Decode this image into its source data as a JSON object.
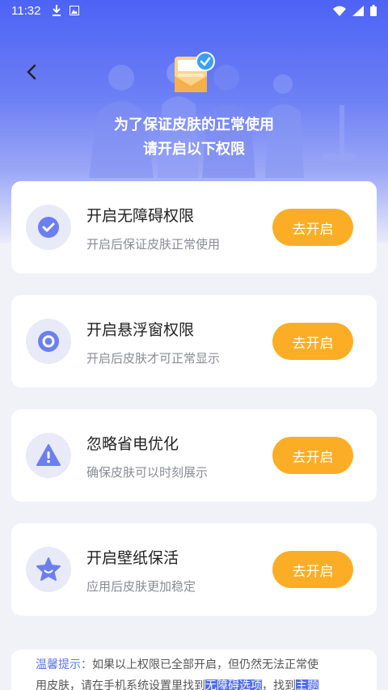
{
  "status_bar": {
    "time": "11:32"
  },
  "header": {
    "line1": "为了保证皮肤的正常使用",
    "line2": "请开启以下权限"
  },
  "permissions": [
    {
      "title": "开启无障碍权限",
      "subtitle": "开启后保证皮肤正常使用",
      "button": "去开启",
      "icon": "checkmark-icon"
    },
    {
      "title": "开启悬浮窗权限",
      "subtitle": "开启后皮肤才可正常显示",
      "button": "去开启",
      "icon": "ring-icon"
    },
    {
      "title": "忽略省电优化",
      "subtitle": "确保皮肤可以时刻展示",
      "button": "去开启",
      "icon": "warning-icon"
    },
    {
      "title": "开启壁纸保活",
      "subtitle": "应用后皮肤更加稳定",
      "button": "去开启",
      "icon": "star-icon"
    }
  ],
  "tips": {
    "label": "温馨提示：",
    "text1": "如果以上权限已全部开启，但仍然无法正常使",
    "text2": "用皮肤，请在手机系统设置里找到",
    "highlight1": "无障碍选项",
    "text3": "，找到",
    "highlight2": "主题"
  },
  "colors": {
    "accent": "#fbae25",
    "primary": "#4d63f5",
    "icon_fg": "#6c7ff0"
  }
}
